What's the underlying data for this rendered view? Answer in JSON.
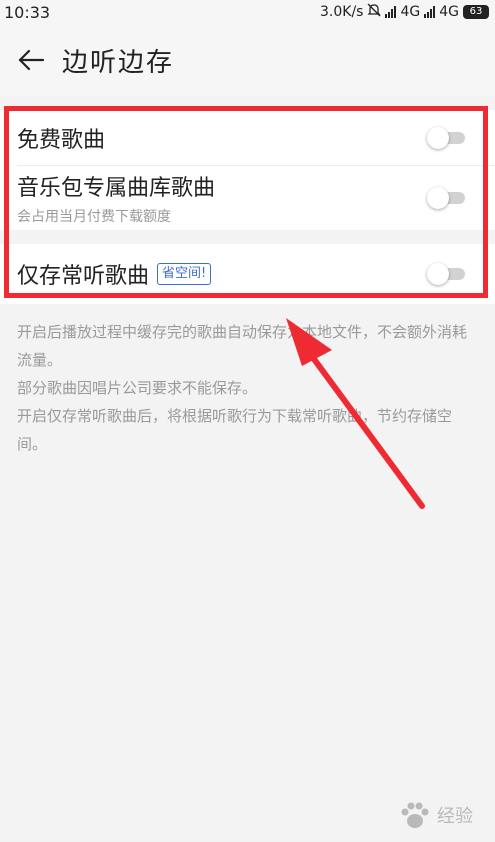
{
  "status_bar": {
    "time": "10:33",
    "network_speed": "3.0K/s",
    "network_1": "4G",
    "network_2": "4G",
    "battery": "63",
    "icons": [
      "mute-icon",
      "signal-icon",
      "signal-icon",
      "battery-icon"
    ]
  },
  "header": {
    "title": "边听边存",
    "back_icon": "arrow-left-icon"
  },
  "settings": [
    {
      "label": "免费歌曲",
      "sublabel": "",
      "enabled": false
    },
    {
      "label": "音乐包专属曲库歌曲",
      "sublabel": "会占用当月付费下载额度",
      "enabled": false
    },
    {
      "label": "仅存常听歌曲",
      "badge": "省空间!",
      "enabled": false
    }
  ],
  "description": [
    "开启后播放过程中缓存完的歌曲自动保存为本地文件，不会额外消耗流量。",
    "部分歌曲因唱片公司要求不能保存。",
    "开启仅存常听歌曲后，将根据听歌行为下载常听歌曲，节约存储空间。"
  ],
  "annotation": {
    "box_color": "#ee2b33",
    "arrow_color": "#ee2b33"
  },
  "watermark": {
    "text": "经验",
    "icon": "paw-icon"
  }
}
